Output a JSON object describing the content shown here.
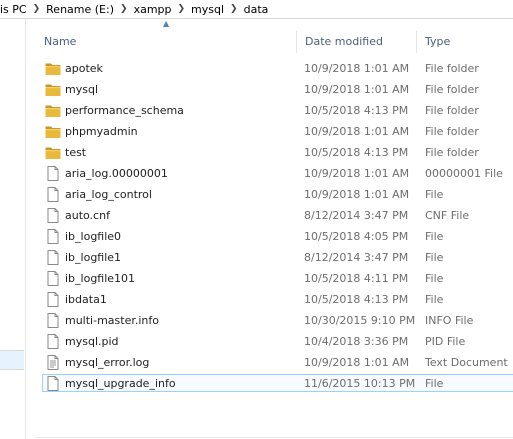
{
  "breadcrumb": [
    "is PC",
    "Rename (E:)",
    "xampp",
    "mysql",
    "data"
  ],
  "columns": {
    "name": "Name",
    "date": "Date modified",
    "type": "Type"
  },
  "files": [
    {
      "name": "apotek",
      "date": "10/9/2018 1:01 AM",
      "type": "File folder",
      "icon": "folder-icon"
    },
    {
      "name": "mysql",
      "date": "10/9/2018 1:01 AM",
      "type": "File folder",
      "icon": "folder-icon"
    },
    {
      "name": "performance_schema",
      "date": "10/5/2018 4:13 PM",
      "type": "File folder",
      "icon": "folder-icon"
    },
    {
      "name": "phpmyadmin",
      "date": "10/9/2018 1:01 AM",
      "type": "File folder",
      "icon": "folder-icon"
    },
    {
      "name": "test",
      "date": "10/5/2018 4:13 PM",
      "type": "File folder",
      "icon": "folder-icon"
    },
    {
      "name": "aria_log.00000001",
      "date": "10/9/2018 1:01 AM",
      "type": "00000001 File",
      "icon": "file-icon"
    },
    {
      "name": "aria_log_control",
      "date": "10/9/2018 1:01 AM",
      "type": "File",
      "icon": "file-icon"
    },
    {
      "name": "auto.cnf",
      "date": "8/12/2014 3:47 PM",
      "type": "CNF File",
      "icon": "file-icon"
    },
    {
      "name": "ib_logfile0",
      "date": "10/5/2018 4:05 PM",
      "type": "File",
      "icon": "file-icon"
    },
    {
      "name": "ib_logfile1",
      "date": "8/12/2014 3:47 PM",
      "type": "File",
      "icon": "file-icon"
    },
    {
      "name": "ib_logfile101",
      "date": "10/5/2018 4:11 PM",
      "type": "File",
      "icon": "file-icon"
    },
    {
      "name": "ibdata1",
      "date": "10/5/2018 4:13 PM",
      "type": "File",
      "icon": "file-icon"
    },
    {
      "name": "multi-master.info",
      "date": "10/30/2015 9:10 PM",
      "type": "INFO File",
      "icon": "file-icon"
    },
    {
      "name": "mysql.pid",
      "date": "10/4/2018 3:36 PM",
      "type": "PID File",
      "icon": "file-icon"
    },
    {
      "name": "mysql_error.log",
      "date": "10/9/2018 1:01 AM",
      "type": "Text Document",
      "icon": "text-document-icon"
    },
    {
      "name": "mysql_upgrade_info",
      "date": "11/6/2015 10:13 PM",
      "type": "File",
      "icon": "file-icon",
      "selected": true
    }
  ],
  "colors": {
    "folder": "#e8b93a",
    "folder_dark": "#c9962a",
    "header_text": "#4c607a",
    "selection_border": "#99d1ff"
  }
}
